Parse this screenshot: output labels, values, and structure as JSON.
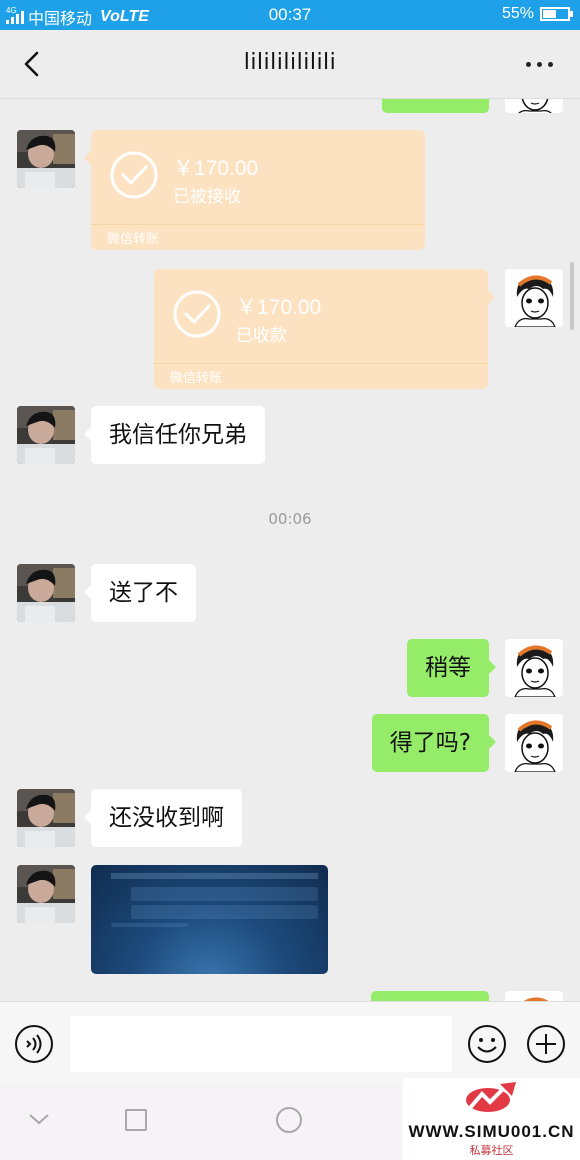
{
  "status_bar": {
    "network_badge": "4G",
    "carrier": "中国移动",
    "volte": "VoLTE",
    "time": "00:37",
    "battery_percent": "55%",
    "battery_level": 0.55
  },
  "header": {
    "title": "lilililililili",
    "back_icon": "chevron-left-icon",
    "more_icon": "more-dots-icon"
  },
  "messages": [
    {
      "id": "m0",
      "side": "out",
      "type": "text",
      "text": ""
    },
    {
      "id": "m1",
      "side": "in",
      "type": "transfer",
      "amount": "￥170.00",
      "status": "已被接收",
      "footer": "微信转账"
    },
    {
      "id": "m2",
      "side": "out",
      "type": "transfer",
      "amount": "￥170.00",
      "status": "已收款",
      "footer": "微信转账"
    },
    {
      "id": "m3",
      "side": "in",
      "type": "text",
      "text": "我信任你兄弟"
    },
    {
      "id": "t1",
      "type": "timestamp",
      "text": "00:06"
    },
    {
      "id": "m4",
      "side": "in",
      "type": "text",
      "text": "送了不"
    },
    {
      "id": "m5",
      "side": "out",
      "type": "text",
      "text": "稍等"
    },
    {
      "id": "m6",
      "side": "out",
      "type": "text",
      "text": "得了吗?"
    },
    {
      "id": "m7",
      "side": "in",
      "type": "text",
      "text": "还没收到啊"
    },
    {
      "id": "m8",
      "side": "in",
      "type": "image",
      "text": ""
    },
    {
      "id": "m9",
      "side": "out",
      "type": "text",
      "text": ""
    }
  ],
  "input_bar": {
    "voice_icon": "voice-icon",
    "input_value": "",
    "emoji_icon": "emoji-icon",
    "plus_icon": "plus-circle-icon"
  },
  "nav_bar": {
    "back_icon": "nav-back-icon",
    "home_icon": "nav-home-icon",
    "recent_icon": "nav-recent-icon"
  },
  "watermark": {
    "site": "WWW.SIMU001.CN",
    "subtitle": "私募社区"
  },
  "colors": {
    "status_bar": "#1ea1e8",
    "outgoing_bubble": "#95ec69",
    "incoming_bubble": "#ffffff",
    "transfer_card": "#fde2c2",
    "background": "#ededed"
  }
}
